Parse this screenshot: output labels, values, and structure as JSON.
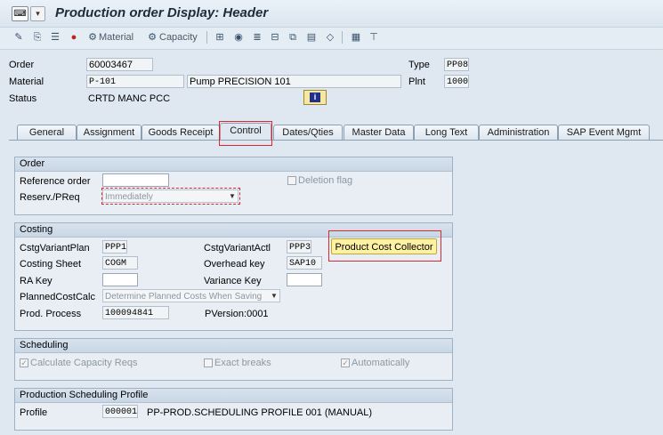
{
  "title": "Production order Display: Header",
  "toolbar": {
    "materials_label": "Material",
    "capacity_label": "Capacity"
  },
  "header": {
    "order_label": "Order",
    "order_value": "60003467",
    "type_label": "Type",
    "type_value": "PP08",
    "material_label": "Material",
    "material_value": "P-101",
    "material_desc": "Pump PRECISION 101",
    "plant_label": "Plnt",
    "plant_value": "1000",
    "status_label": "Status",
    "status_value": "CRTD MANC PCC"
  },
  "tabs": [
    "General",
    "Assignment",
    "Goods Receipt",
    "Control",
    "Dates/Qties",
    "Master Data",
    "Long Text",
    "Administration",
    "SAP Event Mgmt"
  ],
  "order_group": {
    "title": "Order",
    "ref_order_label": "Reference order",
    "ref_order_value": "",
    "deletion_flag_label": "Deletion flag",
    "reserv_label": "Reserv./PReq",
    "reserv_value": "Immediately"
  },
  "costing_group": {
    "title": "Costing",
    "cstg_variant_plan_label": "CstgVariantPlan",
    "cstg_variant_plan_value": "PPP1",
    "cstg_variant_actl_label": "CstgVariantActl",
    "cstg_variant_actl_value": "PPP3",
    "product_cost_collector_label": "Product Cost Collector",
    "costing_sheet_label": "Costing Sheet",
    "costing_sheet_value": "COGM",
    "overhead_key_label": "Overhead key",
    "overhead_key_value": "SAP10",
    "ra_key_label": "RA Key",
    "ra_key_value": "",
    "variance_key_label": "Variance Key",
    "variance_key_value": "",
    "planned_cost_calc_label": "PlannedCostCalc",
    "planned_cost_calc_value": "Determine Planned Costs When Saving",
    "prod_process_label": "Prod. Process",
    "prod_process_value": "100094841",
    "pversion_label": "PVersion:0001"
  },
  "scheduling_group": {
    "title": "Scheduling",
    "calc_capacity_label": "Calculate Capacity Reqs",
    "exact_breaks_label": "Exact breaks",
    "automatically_label": "Automatically"
  },
  "profile_group": {
    "title": "Production Scheduling Profile",
    "profile_label": "Profile",
    "profile_value": "000001",
    "profile_desc": "PP-PROD.SCHEDULING PROFILE 001 (MANUAL)"
  },
  "icons": [
    "sap-logo-icon",
    "menu-icon",
    "edit-icon",
    "copy-icon",
    "list-icon",
    "stop-icon",
    "materials-icon",
    "capacity-icon",
    "hierarchy-icon",
    "cost-icon",
    "components-icon",
    "structure-icon",
    "copy-doc-icon",
    "document-icon",
    "cube-icon",
    "table-icon",
    "tree-icon",
    "info-icon"
  ],
  "colors": {
    "highlight": "#d9282e",
    "pcc_button": "#fdf1a4",
    "background": "#dfe8f1"
  }
}
